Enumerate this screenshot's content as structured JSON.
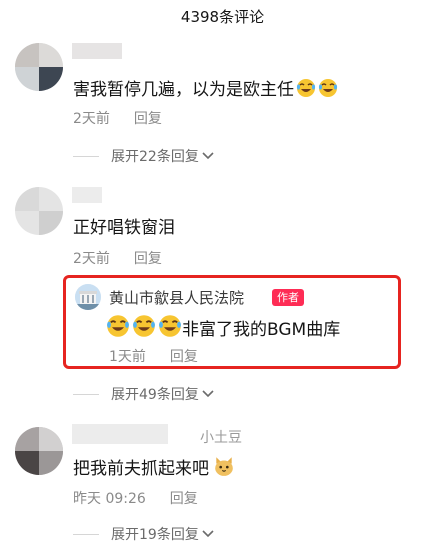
{
  "header": {
    "title": "4398条评论"
  },
  "comments": [
    {
      "text": "害我暂停几遍，以为是欧主任",
      "emoji_count": 2,
      "time": "2天前",
      "reply_label": "回复",
      "expand_label": "展开22条回复"
    },
    {
      "text": "正好唱铁窗泪",
      "time": "2天前",
      "reply_label": "回复",
      "reply": {
        "author": "黄山市歙县人民法院",
        "badge": "作者",
        "text": "非富了我的BGM曲库",
        "emoji_count": 3,
        "time": "1天前",
        "reply_label": "回复"
      },
      "expand_label": "展开49条回复"
    },
    {
      "partial_name": "小土豆",
      "text": "把我前夫抓起来吧",
      "time": "昨天 09:26",
      "reply_label": "回复",
      "expand_label": "展开19条回复"
    }
  ],
  "colors": {
    "highlight": "#e62420",
    "badge": "#fe2c55",
    "emoji_face": "#f7c531"
  },
  "icons": [
    "laughing-crying-emoji",
    "chevron-down-icon",
    "cat-emoji"
  ]
}
